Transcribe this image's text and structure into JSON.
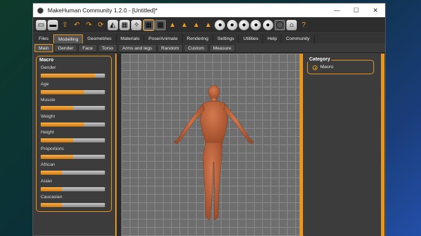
{
  "window": {
    "title": "MakeHuman Community 1.2.0 - [Untitled]*",
    "controls": {
      "minimize": "—",
      "maximize": "☐",
      "close": "✕"
    }
  },
  "toolbar": {
    "icons": [
      {
        "name": "undo-icon",
        "glyph": "↶",
        "style": "orange"
      },
      {
        "name": "redo-icon",
        "glyph": "↷",
        "style": "orange"
      },
      {
        "name": "reset-icon",
        "glyph": "⟳",
        "style": "orange"
      },
      {
        "name": "smooth-icon",
        "glyph": "◭",
        "style": "grey"
      },
      {
        "name": "wireframe-icon",
        "glyph": "▦",
        "style": "grey"
      },
      {
        "name": "pose-icon",
        "glyph": "✧",
        "style": "grey"
      },
      {
        "name": "grid-icon",
        "glyph": "▦",
        "style": "dark"
      },
      {
        "name": "checker-icon",
        "glyph": "▩",
        "style": "dark"
      },
      {
        "name": "front-view-icon",
        "glyph": "▲",
        "style": "orange"
      },
      {
        "name": "back-view-icon",
        "glyph": "▲",
        "style": "orange"
      },
      {
        "name": "left-view-icon",
        "glyph": "▲",
        "style": "orange"
      },
      {
        "name": "right-view-icon",
        "glyph": "▲",
        "style": "orange"
      },
      {
        "name": "top-view-icon",
        "glyph": "●",
        "style": "round"
      },
      {
        "name": "bottom-view-icon",
        "glyph": "●",
        "style": "round"
      },
      {
        "name": "face-view-icon",
        "glyph": "●",
        "style": "round"
      },
      {
        "name": "hand-view-icon",
        "glyph": "●",
        "style": "round"
      },
      {
        "name": "mask-view-icon",
        "glyph": "●",
        "style": "round"
      },
      {
        "name": "ring-view-icon",
        "glyph": "◯",
        "style": "dark"
      },
      {
        "name": "screenshot-icon",
        "glyph": "⌂",
        "style": "grey"
      },
      {
        "name": "help-icon",
        "glyph": "?",
        "style": "orange"
      }
    ]
  },
  "main_tabs": [
    "Files",
    "Modelling",
    "Geometries",
    "Materials",
    "Pose/Animate",
    "Rendering",
    "Settings",
    "Utilities",
    "Help",
    "Community"
  ],
  "main_tab_active": "Modelling",
  "sub_tabs": [
    "Main",
    "Gender",
    "Face",
    "Torso",
    "Arms and legs",
    "Random",
    "Custom",
    "Measure"
  ],
  "sub_tab_active": "Main",
  "macro_panel": {
    "title": "Macro",
    "sliders": [
      {
        "label": "Gender",
        "value": 0.85
      },
      {
        "label": "Age",
        "value": 0.68
      },
      {
        "label": "Muscle",
        "value": 0.5
      },
      {
        "label": "Weight",
        "value": 0.68
      },
      {
        "label": "Height",
        "value": 0.5
      },
      {
        "label": "Proportions",
        "value": 0.5
      },
      {
        "label": "African",
        "value": 0.33
      },
      {
        "label": "Asian",
        "value": 0.33
      },
      {
        "label": "Caucasian",
        "value": 0.33
      }
    ]
  },
  "category_panel": {
    "title": "Category",
    "options": [
      "Macro"
    ],
    "selected": "Macro"
  },
  "colors": {
    "accent": "#e8961c",
    "skin": "#c0623a",
    "background": "#3c3c3c"
  }
}
